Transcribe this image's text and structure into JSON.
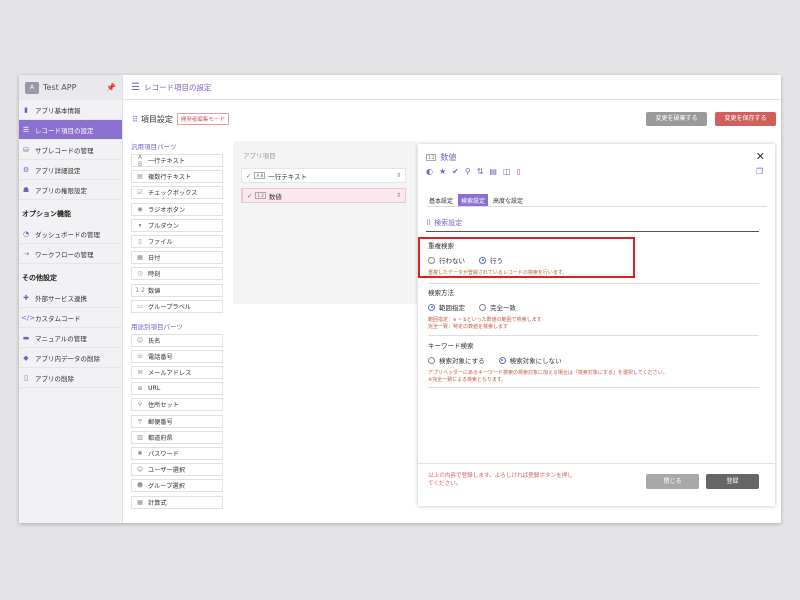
{
  "app": {
    "name": "Test APP",
    "logo_text": "A"
  },
  "header": {
    "title": "レコード項目の設定"
  },
  "sidebar": {
    "items": [
      {
        "label": "アプリ基本情報",
        "icon": "info-icon"
      },
      {
        "label": "レコード項目の設定",
        "icon": "list-icon",
        "active": true
      },
      {
        "label": "サブレコードの管理",
        "icon": "subrecord-icon"
      },
      {
        "label": "アプリ詳細設定",
        "icon": "gear-icon"
      },
      {
        "label": "アプリの権限設定",
        "icon": "user-lock-icon"
      }
    ],
    "option_head": "オプション機能",
    "option_items": [
      {
        "label": "ダッシュボードの管理",
        "icon": "dashboard-icon"
      },
      {
        "label": "ワークフローの管理",
        "icon": "workflow-icon"
      }
    ],
    "other_head": "その他設定",
    "other_items": [
      {
        "label": "外部サービス連携",
        "icon": "puzzle-icon"
      },
      {
        "label": "カスタムコード",
        "icon": "code-icon"
      },
      {
        "label": "マニュアルの管理",
        "icon": "book-icon"
      },
      {
        "label": "アプリ内データの削除",
        "icon": "eraser-icon"
      },
      {
        "label": "アプリの削除",
        "icon": "trash-icon"
      }
    ]
  },
  "main": {
    "section_title": "項目設定",
    "mode_badge": "開発者編集モード",
    "discard_label": "変更を破棄する",
    "save_label": "変更を保存する"
  },
  "parts": {
    "general_head": "汎用項目パーツ",
    "general": [
      "一行テキスト",
      "複数行テキスト",
      "チェックボックス",
      "ラジオボタン",
      "プルダウン",
      "ファイル",
      "日付",
      "時刻",
      "数値",
      "グループラベル"
    ],
    "purpose_head": "用途別項目パーツ",
    "purpose": [
      "氏名",
      "電話番号",
      "メールアドレス",
      "URL",
      "住所セット",
      "郵便番号",
      "都道府県",
      "パスワード",
      "ユーザー選択",
      "グループ選択",
      "計算式"
    ]
  },
  "fields": {
    "label": "アプリ項目",
    "rows": [
      {
        "label": "一行テキスト",
        "icon_text": "A B"
      },
      {
        "label": "数値",
        "icon_text": "1 2"
      }
    ]
  },
  "panel": {
    "title": "数値",
    "title_icon_text": "1 2",
    "tabs": [
      "基本設定",
      "検索設定",
      "高度な設定"
    ],
    "sub_title": "検索設定",
    "groups": [
      {
        "title": "重複検索",
        "options": [
          "行わない",
          "行う"
        ],
        "selected": 1,
        "note": "重複したデータが登録されているレコードの検索を行います。"
      },
      {
        "title": "検索方法",
        "options": [
          "範囲指定",
          "完全一致"
        ],
        "selected": 0,
        "note": "範囲指定：a ~ bといった数値の範囲で検索します\n完全一致：特定の数値を検索します"
      },
      {
        "title": "キーワード検索",
        "options": [
          "検索対象にする",
          "検索対象にしない"
        ],
        "selected": 1,
        "note": "アプリヘッダーにあるキーワード検索の検索対象に加える場合は「検索対象にする」を選択してください。\n※完全一致による検索となります。"
      }
    ],
    "footer_note": "以上の内容で登録します。よろしければ登録ボタンを押してください。",
    "close_label": "閉じる",
    "register_label": "登録"
  },
  "colors": {
    "accent": "#8b6fd1",
    "danger": "#d0605e",
    "highlight": "#e02020"
  }
}
